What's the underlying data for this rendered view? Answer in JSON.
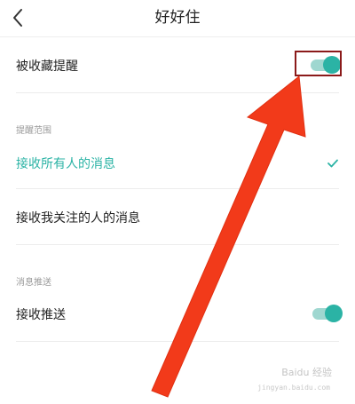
{
  "header": {
    "title": "好好住",
    "back_icon": "chevron-left-icon"
  },
  "favorite_reminder": {
    "label": "被收藏提醒",
    "toggle_on": true
  },
  "reminder_scope": {
    "section_title": "提醒范围",
    "options": [
      {
        "label": "接收所有人的消息",
        "selected": true
      },
      {
        "label": "接收我关注的人的消息",
        "selected": false
      }
    ]
  },
  "push": {
    "section_title": "消息推送",
    "label": "接收推送",
    "toggle_on": true
  },
  "watermark": {
    "text": "Baidu 经验",
    "sub": "jingyan.baidu.com"
  },
  "colors": {
    "accent": "#2bb3a5",
    "track": "#9fd7d0",
    "annotation_arrow": "#f23a1a",
    "highlight_box": "#8b1a1a"
  }
}
